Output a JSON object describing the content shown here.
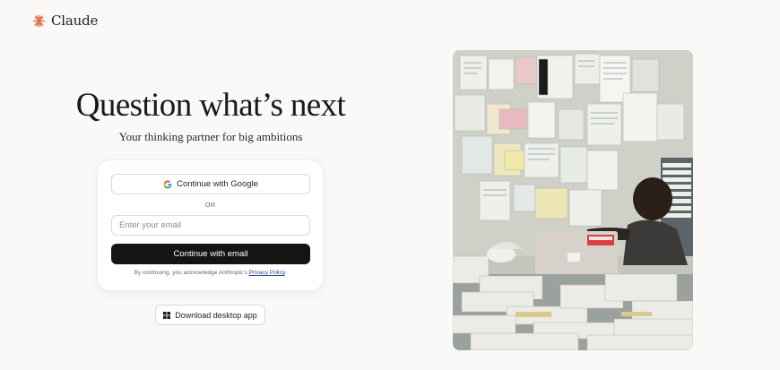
{
  "brand": {
    "name": "Claude",
    "accent": "#d97757"
  },
  "hero": {
    "headline": "Question what’s next",
    "subheadline": "Your thinking partner for big ambitions"
  },
  "login": {
    "google_label": "Continue with Google",
    "or_label": "OR",
    "email_placeholder": "Enter your email",
    "email_value": "",
    "email_button_label": "Continue with email",
    "legal_prefix": "By continuing, you acknowledge Anthropic’s ",
    "legal_link": "Privacy Policy",
    "legal_suffix": "."
  },
  "download": {
    "label": "Download desktop app",
    "icon": "windows-icon"
  },
  "image": {
    "alt": "Person at desk surrounded by papers pinned on wall"
  }
}
